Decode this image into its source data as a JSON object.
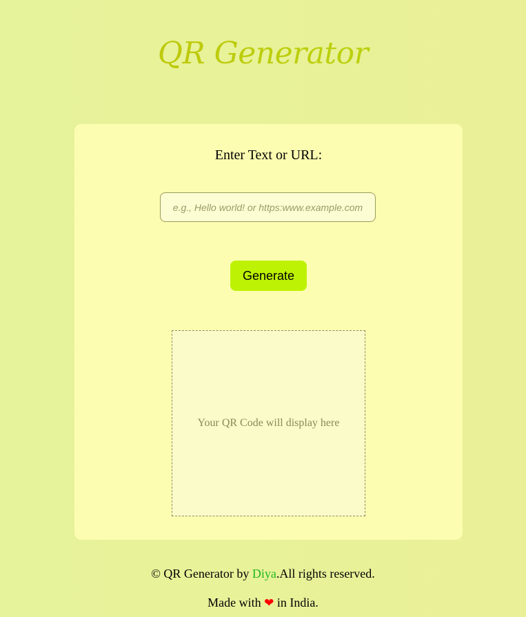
{
  "header": {
    "title": "QR Generator"
  },
  "form": {
    "label": "Enter Text or URL:",
    "input_placeholder": "e.g., Hello world! or https:www.example.com",
    "input_value": "",
    "button_label": "Generate"
  },
  "qr": {
    "placeholder_text": "Your QR Code will display here"
  },
  "footer": {
    "copyright_prefix": "© QR Generator by ",
    "author": "Diya",
    "copyright_suffix": ".All rights reserved.",
    "made_prefix": "Made with ",
    "heart": "❤",
    "made_suffix": " in India."
  },
  "colors": {
    "background": "#e8f298",
    "card": "#fcfdb1",
    "title": "#c2c40c",
    "button": "#bef205",
    "author_link": "#1fb81f",
    "heart": "#ff0000"
  },
  "icons": {
    "heart": "heart-icon"
  }
}
